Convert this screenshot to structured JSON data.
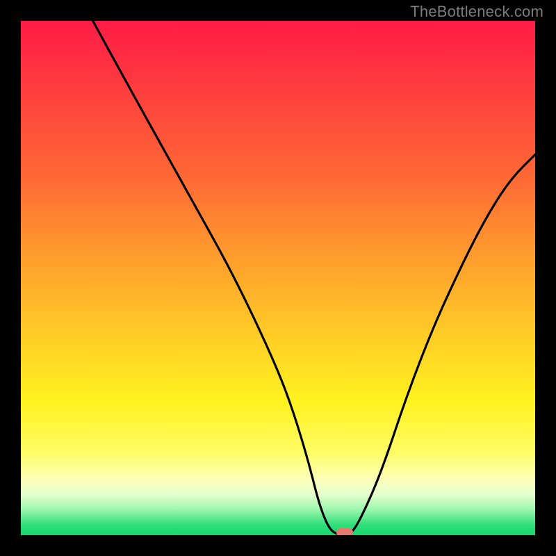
{
  "watermark": "TheBottleneck.com",
  "chart_data": {
    "type": "line",
    "title": "",
    "xlabel": "",
    "ylabel": "",
    "xlim": [
      0,
      100
    ],
    "ylim": [
      0,
      100
    ],
    "grid": false,
    "legend": false,
    "background": {
      "kind": "vertical-gradient",
      "meaning": "bottleneck severity (red high, green low)",
      "stops": [
        {
          "pos": 0,
          "color": "#ff1b46"
        },
        {
          "pos": 12,
          "color": "#ff3a3f"
        },
        {
          "pos": 30,
          "color": "#ff6735"
        },
        {
          "pos": 45,
          "color": "#ff9a2d"
        },
        {
          "pos": 60,
          "color": "#ffc927"
        },
        {
          "pos": 74,
          "color": "#fff21f"
        },
        {
          "pos": 84,
          "color": "#fffc66"
        },
        {
          "pos": 89,
          "color": "#fdffb8"
        },
        {
          "pos": 92,
          "color": "#e7ffce"
        },
        {
          "pos": 95,
          "color": "#9cf7ad"
        },
        {
          "pos": 98,
          "color": "#2fde7a"
        },
        {
          "pos": 100,
          "color": "#18d66e"
        }
      ]
    },
    "series": [
      {
        "name": "bottleneck-curve",
        "color": "#000000",
        "x": [
          14,
          20,
          25,
          30,
          35,
          40,
          45,
          50,
          53,
          56,
          58,
          60,
          62,
          64,
          66,
          70,
          75,
          80,
          85,
          90,
          95,
          100
        ],
        "y": [
          100,
          89,
          80,
          71,
          62,
          53,
          43,
          32,
          24,
          14,
          6,
          1,
          0,
          0,
          3,
          12,
          27,
          40,
          51,
          61,
          69,
          74
        ]
      }
    ],
    "marker": {
      "name": "optimal-point",
      "x": 63,
      "y": 0,
      "color": "#e47a6d"
    }
  }
}
